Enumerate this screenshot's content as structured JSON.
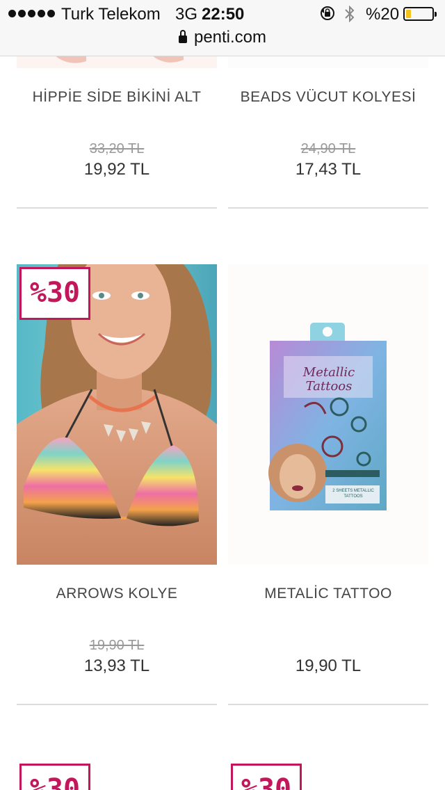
{
  "status_bar": {
    "carrier": "Turk Telekom",
    "network": "3G",
    "time": "22:50",
    "battery_percent": "%20",
    "battery_level": 0.2,
    "battery_color": "#f4c21a"
  },
  "url_bar": {
    "domain": "penti.com"
  },
  "products": [
    {
      "name": "HİPPİE SİDE BİKİNİ ALT",
      "old_price": "33,20 TL",
      "price": "19,92 TL"
    },
    {
      "name": "BEADS VÜCUT KOLYESİ",
      "old_price": "24,90 TL",
      "price": "17,43 TL"
    },
    {
      "name": "ARROWS KOLYE",
      "old_price": "19,90 TL",
      "price": "13,93 TL",
      "badge": "%30"
    },
    {
      "name": "METALİC TATTOO",
      "price": "19,90 TL"
    }
  ],
  "next_row": {
    "badge_left": "%30",
    "badge_right": "%30"
  },
  "tattoo_pack": {
    "title": "Metallic Tattoos",
    "subtitle": "2 SHEETS METALLIC TATTOOS"
  },
  "colors": {
    "badge": "#c2185b",
    "separator": "#dcdcdc"
  }
}
